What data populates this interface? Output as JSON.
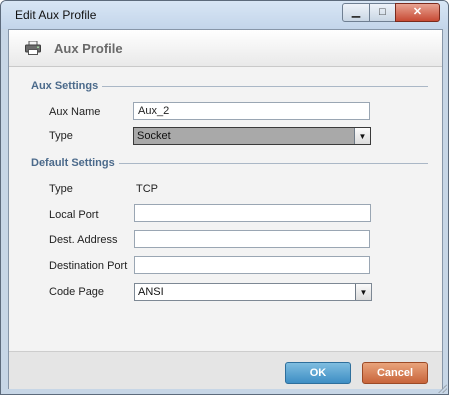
{
  "window": {
    "title": "Edit Aux Profile",
    "minimize_glyph": "▁",
    "maximize_glyph": "□",
    "close_glyph": "✕"
  },
  "header": {
    "icon": "printer-icon",
    "title": "Aux Profile"
  },
  "aux_settings": {
    "section_title": "Aux Settings",
    "aux_name_label": "Aux Name",
    "aux_name_value": "Aux_2",
    "type_label": "Type",
    "type_value": "Socket"
  },
  "default_settings": {
    "section_title": "Default Settings",
    "type_label": "Type",
    "type_value": "TCP",
    "local_port_label": "Local Port",
    "local_port_value": "",
    "dest_address_label": "Dest. Address",
    "dest_address_value": "",
    "destination_port_label": "Destination Port",
    "destination_port_value": "",
    "code_page_label": "Code Page",
    "code_page_value": "ANSI"
  },
  "footer": {
    "ok_label": "OK",
    "cancel_label": "Cancel"
  },
  "colors": {
    "section_title": "#4b6a8b",
    "ok_button": "#3e8ec4",
    "cancel_button": "#c8643a"
  }
}
